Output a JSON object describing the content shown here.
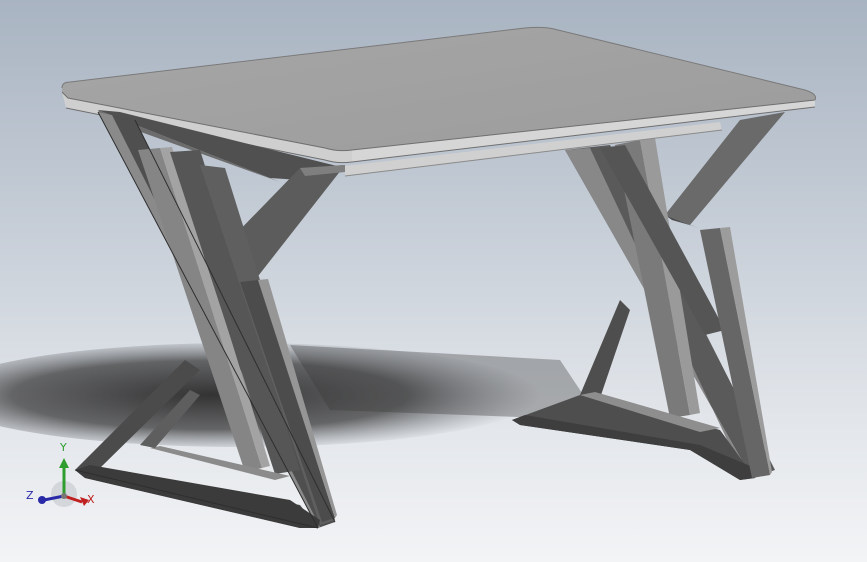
{
  "viewport": {
    "background_top": "#a9b4c2",
    "background_bottom": "#f3f4f6",
    "model": "table"
  },
  "model_colors": {
    "tabletop_top": "#a3a3a3",
    "tabletop_edge": "#c9c9c9",
    "frame_dark": "#4a4a4a",
    "frame_mid": "#5e5e5e",
    "frame_light": "#8c8c8c",
    "shadow": "#303030"
  },
  "triad": {
    "x_label": "X",
    "y_label": "Y",
    "z_label": "Z",
    "x_color": "#c02020",
    "y_color": "#2f9e2f",
    "z_color": "#2a2aa8"
  }
}
